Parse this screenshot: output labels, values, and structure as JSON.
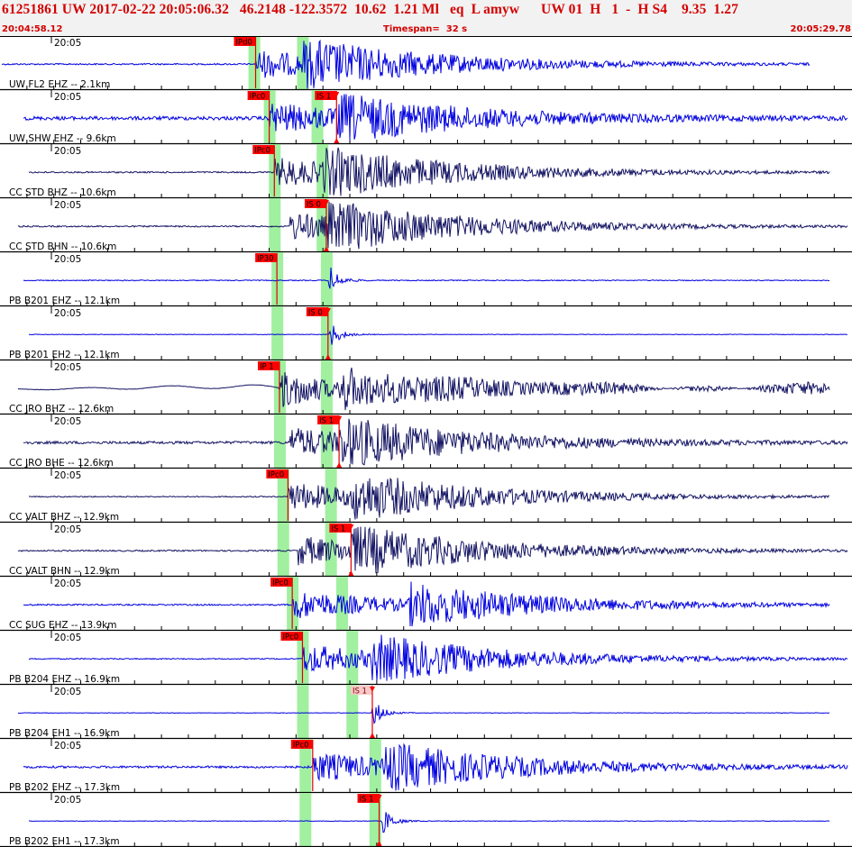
{
  "header": {
    "title": "61251861 UW 2017-02-22 20:05:06.32   46.2148 -122.3572  10.62  1.21 Ml   eq  L amyw      UW 01  H   1  -  H S4    9.35  1.27",
    "start_time": "20:04:58.12",
    "timespan": "Timespan=  32 s",
    "end_time": "20:05:29.78"
  },
  "colors": {
    "trace_blue": "#0000e0",
    "trace_dark": "#141464",
    "pick_red": "#dd0000",
    "window_green": "#a0f0a0",
    "label_red": "#d40000"
  },
  "traces": [
    {
      "time": "20:05",
      "label": "UW FL2 EHZ -- 2.1km",
      "color": "blue",
      "shape": "burst",
      "noise": 0.8,
      "picks": [
        {
          "text": "IPd0",
          "t": 0.3,
          "pale": false
        }
      ],
      "windows": [
        0.298,
        0.355
      ],
      "p": 0.3,
      "s": 0.355
    },
    {
      "time": "20:05",
      "label": "UW SHW EHZ -- 9.6km",
      "color": "blue",
      "shape": "burst",
      "noise": 2,
      "picks": [
        {
          "text": "IPc0",
          "t": 0.316,
          "pale": false
        },
        {
          "text": "IS 1",
          "t": 0.395,
          "pale": false
        }
      ],
      "windows": [
        0.316,
        0.372
      ],
      "p": 0.316,
      "s": 0.395
    },
    {
      "time": "20:05",
      "label": "CC STD BHZ -- 10.6km",
      "color": "dark",
      "shape": "burst",
      "noise": 0.8,
      "picks": [
        {
          "text": "IPc0",
          "t": 0.322,
          "pale": false
        }
      ],
      "windows": [
        0.322,
        0.378
      ],
      "p": 0.322,
      "s": 0.378
    },
    {
      "time": "20:05",
      "label": "CC STD BHN -- 10.6km",
      "color": "dark",
      "shape": "burst",
      "noise": 0.8,
      "picks": [
        {
          "text": "IS 0",
          "t": 0.383,
          "pale": false
        }
      ],
      "windows": [
        0.322,
        0.378
      ],
      "p": 0.34,
      "s": 0.383
    },
    {
      "time": "20:05",
      "label": "PB B201 EHZ -- 12.1km",
      "color": "blue",
      "shape": "spike",
      "noise": 0.5,
      "picks": [
        {
          "text": "IP30",
          "t": 0.325,
          "pale": false
        }
      ],
      "windows": [
        0.325,
        0.383
      ],
      "p": 0.325,
      "s": 0.386
    },
    {
      "time": "20:05",
      "label": "PB B201 EH2 -- 12.1km",
      "color": "blue",
      "shape": "spike",
      "noise": 0.3,
      "picks": [
        {
          "text": "IS 0",
          "t": 0.385,
          "pale": false
        }
      ],
      "windows": [
        0.325,
        0.383
      ],
      "p": 0.34,
      "s": 0.386
    },
    {
      "time": "20:05",
      "label": "CC JRO BHZ -- 12.6km",
      "color": "dark",
      "shape": "wave",
      "noise": 0.5,
      "picks": [
        {
          "text": "IP 1",
          "t": 0.328,
          "pale": false
        }
      ],
      "windows": [
        0.328,
        0.383
      ],
      "p": 0.328,
      "s": 0.398
    },
    {
      "time": "20:05",
      "label": "CC JRO BHE -- 12.6km",
      "color": "dark",
      "shape": "burst",
      "noise": 1.5,
      "picks": [
        {
          "text": "IS 1",
          "t": 0.398,
          "pale": false
        }
      ],
      "windows": [
        0.328,
        0.383
      ],
      "p": 0.34,
      "s": 0.398
    },
    {
      "time": "20:05",
      "label": "CC VALT BHZ -- 12.9km",
      "color": "dark",
      "shape": "burst",
      "noise": 0.6,
      "picks": [
        {
          "text": "IPc0",
          "t": 0.338,
          "pale": false
        }
      ],
      "windows": [
        0.332,
        0.388
      ],
      "p": 0.338,
      "s": 0.412
    },
    {
      "time": "20:05",
      "label": "CC VALT BHN -- 12.9km",
      "color": "dark",
      "shape": "burst",
      "noise": 0.8,
      "picks": [
        {
          "text": "IS 1",
          "t": 0.412,
          "pale": false
        }
      ],
      "windows": [
        0.332,
        0.388
      ],
      "p": 0.35,
      "s": 0.412
    },
    {
      "time": "20:05",
      "label": "CC SUG EHZ -- 13.9km",
      "color": "blue",
      "shape": "burst",
      "noise": 0.8,
      "picks": [
        {
          "text": "IPc0",
          "t": 0.343,
          "pale": false
        }
      ],
      "windows": [
        0.343,
        0.401
      ],
      "p": 0.343,
      "s": 0.48
    },
    {
      "time": "20:05",
      "label": "PB B204 EHZ -- 16.9km",
      "color": "blue",
      "shape": "burst",
      "noise": 0.6,
      "picks": [
        {
          "text": "IPc0",
          "t": 0.355,
          "pale": false
        }
      ],
      "windows": [
        0.355,
        0.413
      ],
      "p": 0.355,
      "s": 0.437
    },
    {
      "time": "20:05",
      "label": "PB B204 EH1 -- 16.9km",
      "color": "blue",
      "shape": "spike",
      "noise": 0.3,
      "picks": [
        {
          "text": "IS 1",
          "t": 0.437,
          "pale": true
        }
      ],
      "windows": [
        0.355,
        0.413
      ],
      "p": 0.37,
      "s": 0.437
    },
    {
      "time": "20:05",
      "label": "PB B202 EHZ -- 17.3km",
      "color": "blue",
      "shape": "burst",
      "noise": 1.2,
      "picks": [
        {
          "text": "IPc0",
          "t": 0.367,
          "pale": false
        }
      ],
      "windows": [
        0.358,
        0.44
      ],
      "p": 0.367,
      "s": 0.45
    },
    {
      "time": "20:05",
      "label": "PB B202 EH1 -- 17.3km",
      "color": "blue",
      "shape": "spike",
      "noise": 0.3,
      "picks": [
        {
          "text": "IS 1",
          "t": 0.445,
          "pale": false
        }
      ],
      "windows": [
        0.358,
        0.44
      ],
      "p": 0.38,
      "s": 0.448
    }
  ]
}
